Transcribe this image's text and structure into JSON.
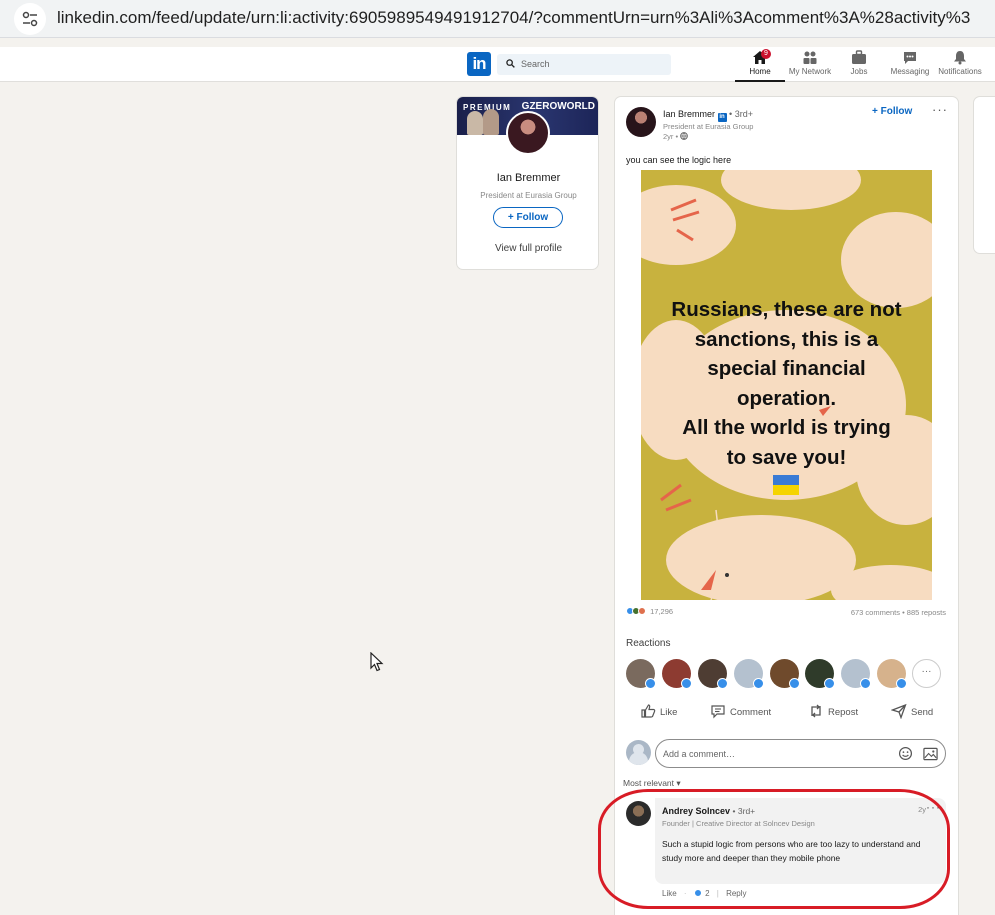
{
  "browser": {
    "url": "linkedin.com/feed/update/urn:li:activity:6905989549491912704/?commentUrn=urn%3Ali%3Acomment%3A%28activity%3"
  },
  "nav": {
    "logo": "in",
    "search_placeholder": "Search",
    "items": [
      {
        "label": "Home",
        "badge": "9"
      },
      {
        "label": "My Network"
      },
      {
        "label": "Jobs"
      },
      {
        "label": "Messaging"
      },
      {
        "label": "Notifications"
      }
    ]
  },
  "profile": {
    "banner_premium": "PREMIUM",
    "banner_brand": "GZEROWORLD",
    "name": "Ian Bremmer",
    "title": "President at Eurasia Group",
    "follow_label": "+ Follow",
    "view_profile_label": "View full profile"
  },
  "post": {
    "author": "Ian Bremmer",
    "linkedin_badge": "in",
    "degree": "• 3rd+",
    "author_title": "President at Eurasia Group",
    "age": "2yr •",
    "follow_label": "+ Follow",
    "more_label": "···",
    "text": "you can see the logic here",
    "image_text_lines": [
      "Russians, these are not",
      "sanctions, this is a",
      "special financial",
      "operation.",
      "All the world is trying",
      "to save you!"
    ],
    "reaction_count": "17,296",
    "comments_reposts": "673 comments • 885 reposts",
    "reactions_label": "Reactions",
    "reactions_more": "···",
    "actions": {
      "like": "Like",
      "comment": "Comment",
      "repost": "Repost",
      "send": "Send"
    },
    "comment_placeholder": "Add a comment…",
    "sort_label": "Most relevant ▾"
  },
  "comment": {
    "author": "Andrey Solncev",
    "degree": "• 3rd+",
    "age": "2y",
    "more_label": "···",
    "title": "Founder | Creative Director at Solncev Design",
    "text": "Such a stupid logic from persons who are too lazy to understand and study more and deeper than they mobile phone",
    "like_label": "Like",
    "reaction_count": "2",
    "reply_label": "Reply"
  },
  "colors": {
    "brand": "#0a66c2",
    "annotation": "#d81c26",
    "image_bg": "#c8b23e"
  }
}
